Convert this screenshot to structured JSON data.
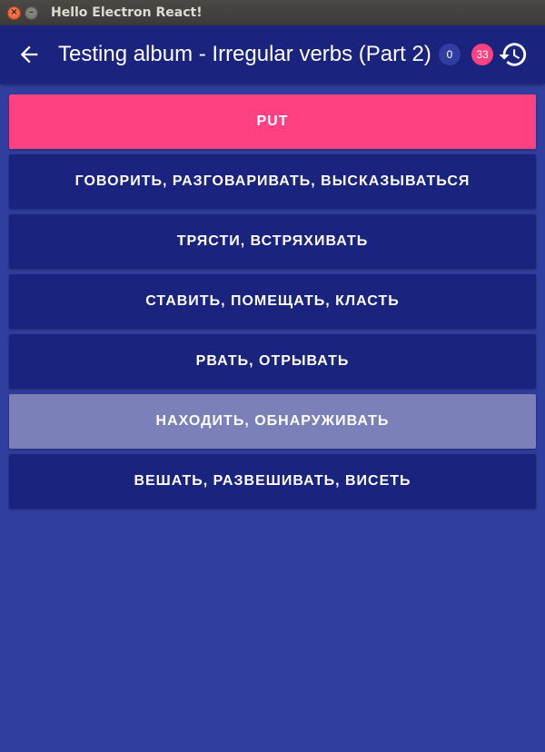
{
  "window": {
    "title": "Hello Electron React!"
  },
  "appbar": {
    "title": "Testing album - Irregular verbs (Part 2)",
    "badge_correct": "0",
    "badge_total": "33",
    "back_icon": "arrow-left",
    "history_icon": "history"
  },
  "question": {
    "word": "PUT"
  },
  "answers": [
    "ГОВОРИТЬ, РАЗГОВАРИВАТЬ, ВЫСКАЗЫВАТЬСЯ",
    "ТРЯСТИ, ВСТРЯХИВАТЬ",
    "СТАВИТЬ, ПОМЕЩАТЬ, КЛАСТЬ",
    "РВАТЬ, ОТРЫВАТЬ",
    "НАХОДИТЬ, ОБНАРУЖИВАТЬ",
    "ВЕШАТЬ, РАЗВЕШИВАТЬ, ВИСЕТЬ"
  ],
  "colors": {
    "background": "#303f9f",
    "appbar": "#1a237e",
    "accent": "#ff4081",
    "answer": "#1a237e",
    "answer_faded": "#7b80b8"
  }
}
